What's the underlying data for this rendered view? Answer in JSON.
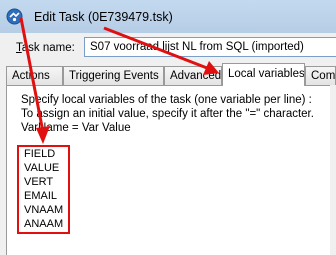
{
  "window": {
    "title": "Edit Task (0E739479.tsk)",
    "icon": "gear-task-icon"
  },
  "task": {
    "label": "Task name:",
    "value": "S07 voorraad lijst NL from SQL (imported)"
  },
  "tabs": [
    {
      "label": "Actions"
    },
    {
      "label": "Triggering Events"
    },
    {
      "label": "Advanced"
    },
    {
      "label": "Local variables"
    },
    {
      "label": "Commands"
    }
  ],
  "active_tab": "Local variables",
  "description": [
    "Specify local variables of the task (one variable per line) :",
    "To assign an initial value, specify it after the \"=\" character.",
    "VarName = Var Value"
  ],
  "variables": [
    "FIELD",
    "VALUE",
    "VERT",
    "EMAIL",
    "VNAAM",
    "ANAAM"
  ],
  "annotation_color": "#e01010"
}
